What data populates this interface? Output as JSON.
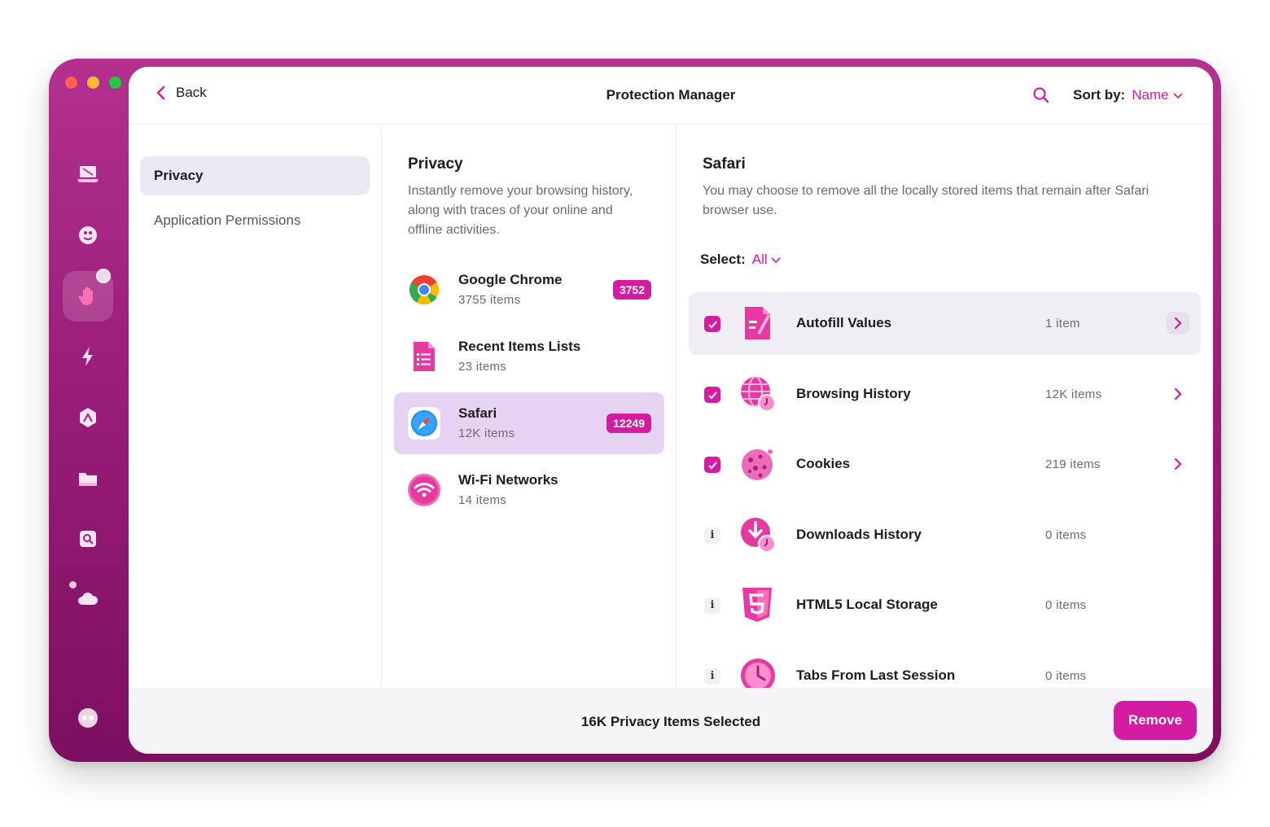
{
  "header": {
    "back_label": "Back",
    "title": "Protection Manager",
    "sort_label": "Sort by:",
    "sort_value": "Name"
  },
  "categories": [
    {
      "label": "Privacy",
      "active": true
    },
    {
      "label": "Application Permissions",
      "active": false
    }
  ],
  "privacy_panel": {
    "title": "Privacy",
    "description": "Instantly remove your browsing history, along with traces of your online and offline activities.",
    "apps": [
      {
        "name": "Google Chrome",
        "count": "3755 items",
        "badge": "3752",
        "icon": "chrome-icon"
      },
      {
        "name": "Recent Items Lists",
        "count": "23 items",
        "badge": "",
        "icon": "document-list-icon"
      },
      {
        "name": "Safari",
        "count": "12K items",
        "badge": "12249",
        "icon": "safari-compass-icon"
      },
      {
        "name": "Wi-Fi Networks",
        "count": "14 items",
        "badge": "",
        "icon": "wifi-icon"
      }
    ]
  },
  "detail_panel": {
    "title": "Safari",
    "description": "You may choose to remove all the locally stored items that remain after Safari browser use.",
    "select_label": "Select:",
    "select_value": "All",
    "items": [
      {
        "label": "Autofill Values",
        "count": "1 item",
        "checked": true,
        "icon": "autofill-document-icon"
      },
      {
        "label": "Browsing History",
        "count": "12K items",
        "checked": true,
        "icon": "globe-clock-icon"
      },
      {
        "label": "Cookies",
        "count": "219 items",
        "checked": true,
        "icon": "cookie-icon"
      },
      {
        "label": "Downloads History",
        "count": "0 items",
        "checked": false,
        "icon": "download-clock-icon"
      },
      {
        "label": "HTML5 Local Storage",
        "count": "0 items",
        "checked": false,
        "icon": "html5-icon"
      },
      {
        "label": "Tabs From Last Session",
        "count": "0 items",
        "checked": false,
        "icon": "clock-icon"
      }
    ]
  },
  "footer": {
    "status": "16K Privacy Items Selected",
    "remove_label": "Remove"
  },
  "colors": {
    "accent": "#d41ca2",
    "sidebar_top": "#b3308f",
    "sidebar_bottom": "#7c0f5f"
  }
}
